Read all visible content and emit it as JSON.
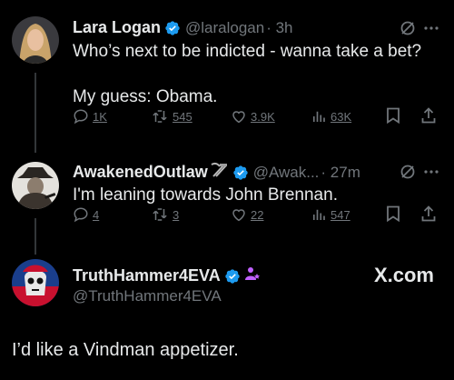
{
  "tweet1": {
    "name": "Lara Logan",
    "handle": "@laralogan",
    "time": "· 3h",
    "line1": "Who’s next to be indicted - wanna take a bet?",
    "line2": "My guess: Obama.",
    "replies": "1K",
    "retweets": "545",
    "likes": "3.9K",
    "views": "63K"
  },
  "tweet2": {
    "name": "AwakenedOutlaw",
    "handle": "@Awak...",
    "time": "· 27m",
    "text": "I'm leaning towards John Brennan.",
    "replies": "4",
    "retweets": "3",
    "likes": "22",
    "views": "547"
  },
  "tweet3": {
    "name": "TruthHammer4EVA",
    "handle": "@TruthHammer4EVA",
    "text": "I’d like a Vindman appetizer."
  },
  "watermark": "X.com",
  "colors": {
    "background": "#000000",
    "text": "#e7e9ea",
    "muted": "#71767b",
    "verified": "#1d9bf0",
    "affiliate": "#c061ff"
  },
  "icons": [
    "grok-icon",
    "more-icon",
    "reply-icon",
    "retweet-icon",
    "like-icon",
    "views-icon",
    "bookmark-icon",
    "share-icon",
    "verified-badge-icon",
    "hammer-pick-icon",
    "affiliate-badge-icon"
  ]
}
